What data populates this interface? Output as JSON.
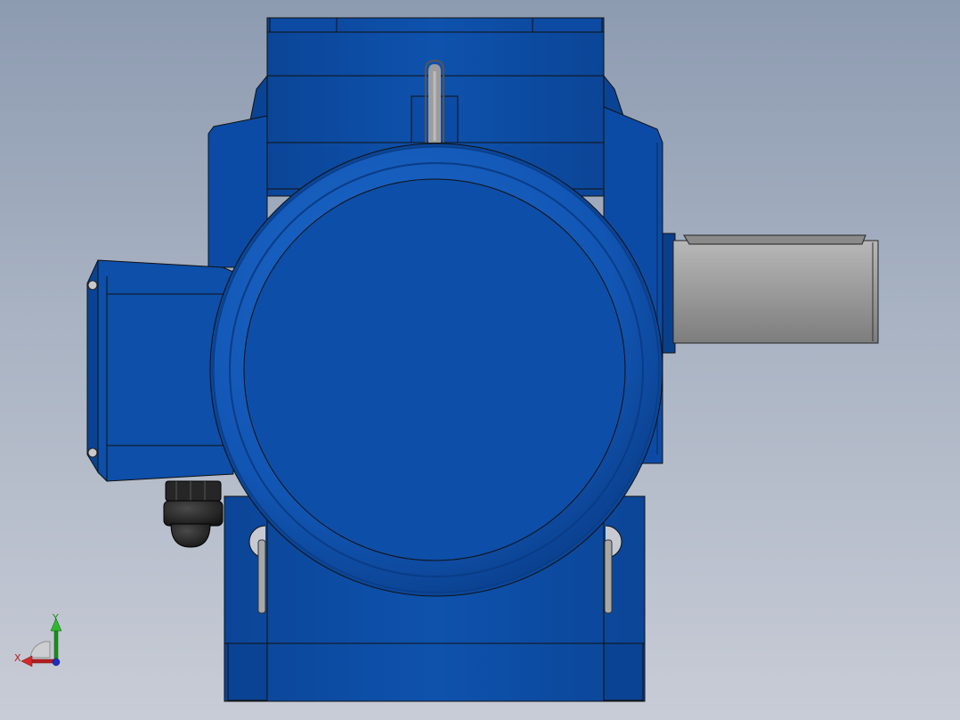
{
  "viewport": {
    "background_top": "#8d9bb1",
    "background_bottom": "#c8ccd6"
  },
  "model": {
    "body_color": "#0d4ea8",
    "body_dark": "#093c86",
    "body_light": "#1a66c6",
    "shaft_color": "#9a9a9a",
    "eyebolt_color": "#8e8e8e",
    "gland_color": "#2a2a2a"
  },
  "triad": {
    "x_label": "X",
    "y_label": "Y",
    "x_color": "#b81c1c",
    "y_color": "#1d8c1d",
    "z_color": "#1e2fbf"
  }
}
